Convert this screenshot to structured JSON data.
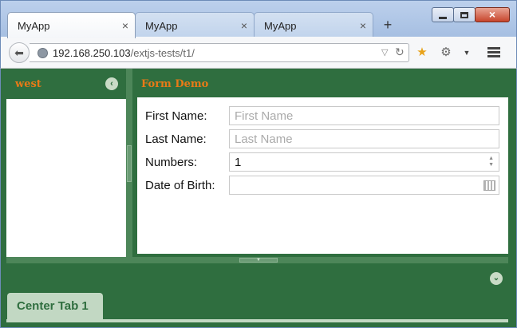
{
  "browser": {
    "tabs": [
      {
        "title": "MyApp",
        "close": "×"
      },
      {
        "title": "MyApp",
        "close": "×"
      },
      {
        "title": "MyApp",
        "close": "×"
      }
    ],
    "new_tab": "+",
    "address_host": "192.168.250.103",
    "address_path": "/extjs-tests/t1/",
    "icons": [
      "back-icon",
      "globe-icon",
      "dropdown-icon",
      "reload-icon",
      "bookmark-star-icon",
      "settings-gear-icon",
      "menu-icon"
    ]
  },
  "window": {
    "minimize": "minimize",
    "maximize": "maximize",
    "close": "×"
  },
  "app": {
    "west_panel": {
      "title": "west",
      "collapse_icon": "collapse-left-icon"
    },
    "center_panel": {
      "title": "Form Demo",
      "fields": [
        {
          "label": "First Name:",
          "value": "",
          "placeholder": "First Name"
        },
        {
          "label": "Last Name:",
          "value": "",
          "placeholder": "Last Name"
        },
        {
          "label": "Numbers:",
          "value": "1",
          "placeholder": ""
        },
        {
          "label": "Date of Birth:",
          "value": "",
          "placeholder": ""
        }
      ]
    },
    "south_panel": {
      "collapse_icon": "collapse-down-icon"
    },
    "tabs": [
      {
        "label": "Center Tab 1"
      }
    ],
    "colors": {
      "panel_bg": "#2f6e3f",
      "title_orange": "#e87a17",
      "tab_bg": "#c2d8c3"
    }
  }
}
